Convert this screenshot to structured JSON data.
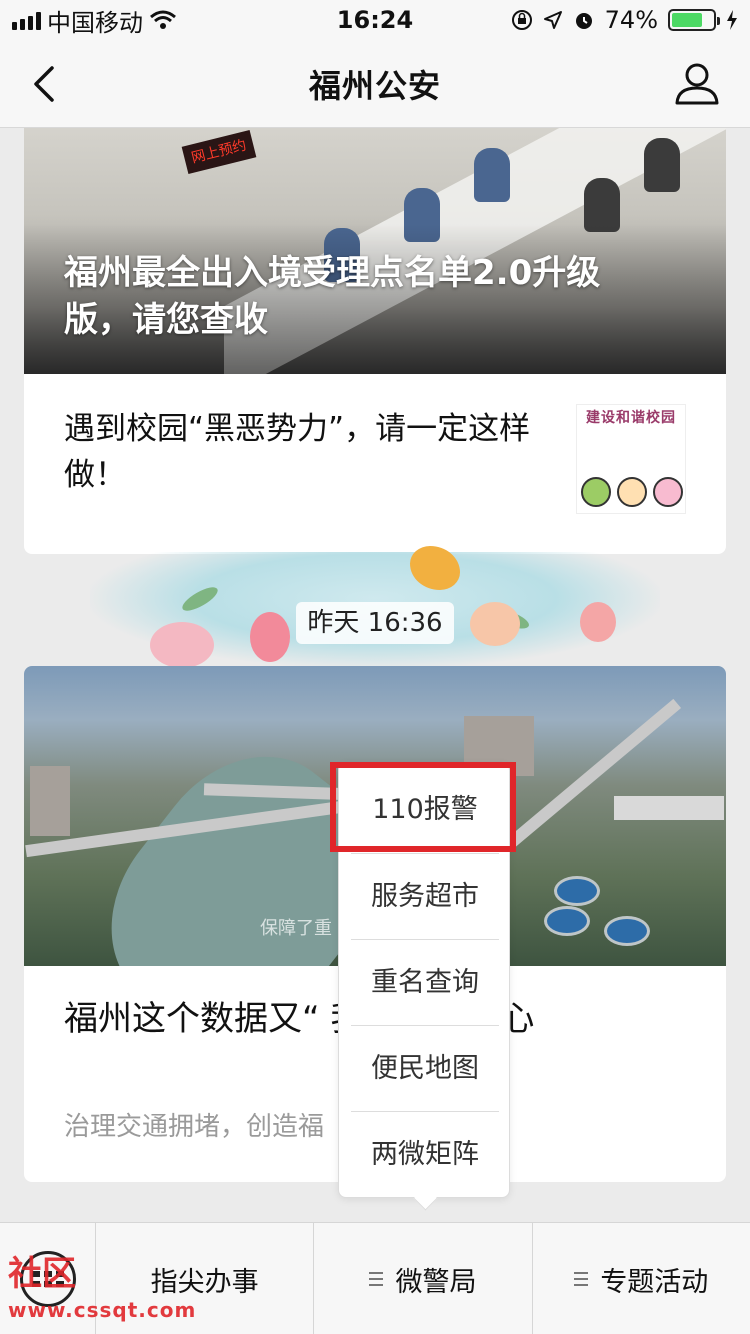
{
  "status_bar": {
    "carrier": "中国移动",
    "time": "16:24",
    "battery_percent": "74%",
    "battery_level": 0.74
  },
  "nav": {
    "title": "福州公安"
  },
  "articles": {
    "top_headline": "福州最全出入境受理点名单2.0升级版，请您查收",
    "item_title": "遇到校园“黑恶势力”，请一定这样做！",
    "item_thumb_caption": "建设和谐校园",
    "date_divider": "昨天 16:36",
    "card2_image_caption": "保障了重",
    "card2_title": "福州这个数据又“        我们却很开心",
    "card2_summary": "治理交通拥堵，创造福"
  },
  "popup_menu": {
    "items": [
      "110报警",
      "服务超市",
      "重名查询",
      "便民地图",
      "两微矩阵"
    ]
  },
  "bottom_menu": {
    "tabs": [
      "指尖办事",
      "微警局",
      "专题活动"
    ]
  },
  "watermark": {
    "text": "社区",
    "url": "www.cssqt.com"
  },
  "colors": {
    "highlight": "#e0262a",
    "battery_green": "#4cd964"
  }
}
